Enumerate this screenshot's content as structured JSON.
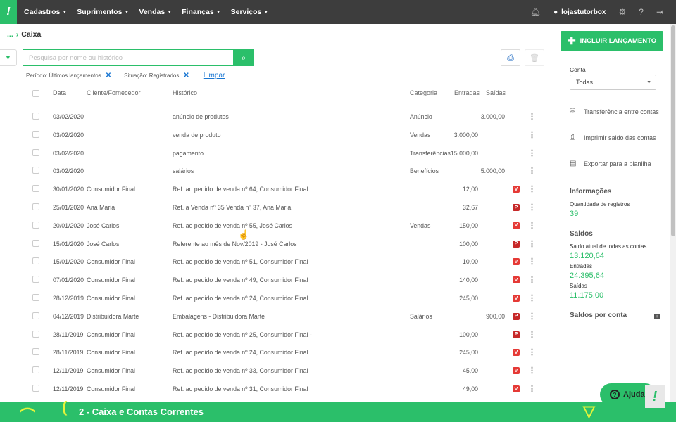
{
  "nav": {
    "items": [
      {
        "label": "Cadastros"
      },
      {
        "label": "Suprimentos"
      },
      {
        "label": "Vendas"
      },
      {
        "label": "Finanças"
      },
      {
        "label": "Serviços"
      }
    ],
    "username": "lojastutorbox"
  },
  "breadcrumb": {
    "dots": "...",
    "current": "Caixa"
  },
  "search": {
    "placeholder": "Pesquisa por nome ou histórico"
  },
  "filters": {
    "periodo": "Período: Últimos lançamentos",
    "situacao": "Situação: Registrados",
    "clear_label": "Limpar"
  },
  "table": {
    "headers": [
      "Data",
      "Cliente/Fornecedor",
      "Histórico",
      "Categoria",
      "Entradas",
      "Saídas"
    ],
    "rows": [
      {
        "date": "03/02/2020",
        "client": "",
        "history": "anúncio de produtos",
        "category": "Anúncio",
        "in": "",
        "out": "3.000,00",
        "badge": ""
      },
      {
        "date": "03/02/2020",
        "client": "",
        "history": "venda de produto",
        "category": "Vendas",
        "in": "3.000,00",
        "out": "",
        "badge": ""
      },
      {
        "date": "03/02/2020",
        "client": "",
        "history": "pagamento",
        "category": "Transferências",
        "in": "15.000,00",
        "out": "",
        "badge": ""
      },
      {
        "date": "03/02/2020",
        "client": "",
        "history": "salários",
        "category": "Benefícios",
        "in": "",
        "out": "5.000,00",
        "badge": ""
      },
      {
        "date": "30/01/2020",
        "client": "Consumidor Final",
        "history": "Ref. ao pedido de venda nº 64, Consumidor Final",
        "category": "",
        "in": "12,00",
        "out": "",
        "badge": "V"
      },
      {
        "date": "25/01/2020",
        "client": "Ana Maria",
        "history": "Ref. a Venda nº 35 Venda nº 37, Ana Maria",
        "category": "",
        "in": "32,67",
        "out": "",
        "badge": "P"
      },
      {
        "date": "20/01/2020",
        "client": "José Carlos",
        "history": "Ref. ao pedido de venda nº 55, José Carlos",
        "category": "Vendas",
        "in": "150,00",
        "out": "",
        "badge": "V"
      },
      {
        "date": "15/01/2020",
        "client": "José Carlos",
        "history": "Referente ao mês de Nov/2019 - José Carlos",
        "category": "",
        "in": "100,00",
        "out": "",
        "badge": "P"
      },
      {
        "date": "15/01/2020",
        "client": "Consumidor Final",
        "history": "Ref. ao pedido de venda nº 51, Consumidor Final",
        "category": "",
        "in": "10,00",
        "out": "",
        "badge": "V"
      },
      {
        "date": "07/01/2020",
        "client": "Consumidor Final",
        "history": "Ref. ao pedido de venda nº 49, Consumidor Final",
        "category": "",
        "in": "140,00",
        "out": "",
        "badge": "V"
      },
      {
        "date": "28/12/2019",
        "client": "Consumidor Final",
        "history": "Ref. ao pedido de venda nº 24, Consumidor Final",
        "category": "",
        "in": "245,00",
        "out": "",
        "badge": "V"
      },
      {
        "date": "04/12/2019",
        "client": "Distribuidora Marte",
        "history": "Embalagens - Distribuidora Marte",
        "category": "Salários",
        "in": "",
        "out": "900,00",
        "badge": "P"
      },
      {
        "date": "28/11/2019",
        "client": "Consumidor Final",
        "history": "Ref. ao pedido de venda nº 25, Consumidor Final -",
        "category": "",
        "in": "100,00",
        "out": "",
        "badge": "P"
      },
      {
        "date": "28/11/2019",
        "client": "Consumidor Final",
        "history": "Ref. ao pedido de venda nº 24, Consumidor Final",
        "category": "",
        "in": "245,00",
        "out": "",
        "badge": "V"
      },
      {
        "date": "12/11/2019",
        "client": "Consumidor Final",
        "history": "Ref. ao pedido de venda nº 33, Consumidor Final",
        "category": "",
        "in": "45,00",
        "out": "",
        "badge": "V"
      },
      {
        "date": "12/11/2019",
        "client": "Consumidor Final",
        "history": "Ref. ao pedido de venda nº 31, Consumidor Final",
        "category": "",
        "in": "49,00",
        "out": "",
        "badge": "V"
      }
    ]
  },
  "sidebar": {
    "add_label": "INCLUIR LANÇAMENTO",
    "conta_label": "Conta",
    "conta_value": "Todas",
    "links": [
      "Transferência entre contas",
      "Imprimir saldo das contas",
      "Exportar para a planilha"
    ],
    "info_title": "Informações",
    "qty_label": "Quantidade de registros",
    "qty_value": "39",
    "saldos_title": "Saldos",
    "saldo_label": "Saldo atual de todas as contas",
    "saldo_value": "13.120,64",
    "entradas_label": "Entradas",
    "entradas_value": "24.395,64",
    "saidas_label": "Saídas",
    "saidas_value": "11.175,00",
    "por_conta": "Saldos por conta"
  },
  "banner": {
    "title": "2 - Caixa e Contas Correntes"
  },
  "help": {
    "label": "Ajuda"
  },
  "colors": {
    "accent": "#2bbf6a",
    "topbar": "#3d3d3d",
    "badge_v": "#e53935",
    "badge_p": "#c62828",
    "link": "#1976d2"
  }
}
